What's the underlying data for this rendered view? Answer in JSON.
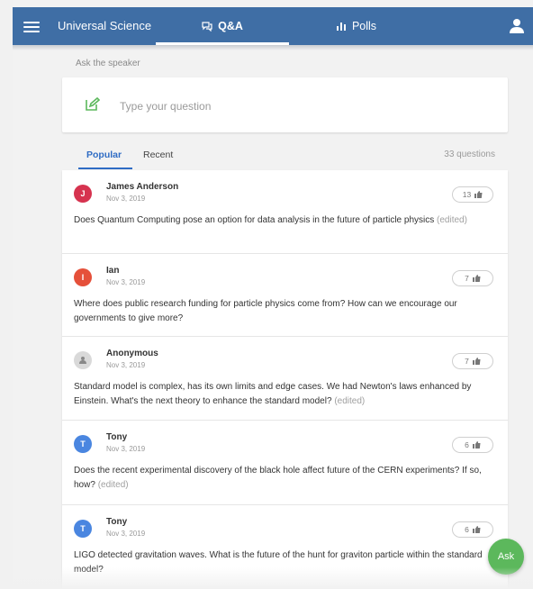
{
  "header": {
    "brand": "Universal Science",
    "tabs": [
      {
        "label": "Q&A",
        "icon": "chat-bubbles-icon",
        "active": true
      },
      {
        "label": "Polls",
        "icon": "bar-chart-icon",
        "active": false
      }
    ],
    "colors": {
      "bar": "#3f6ea5",
      "text": "#ffffff"
    }
  },
  "ask": {
    "label": "Ask the speaker",
    "placeholder": "Type your question",
    "accent": "#5cb85c"
  },
  "sort": {
    "tabs": [
      "Popular",
      "Recent"
    ],
    "active": "Popular",
    "count": "33 questions",
    "accent": "#2f6cc4"
  },
  "questions": [
    {
      "initial": "J",
      "author": "James Anderson",
      "date": "Nov 3, 2019",
      "likes": "13",
      "text": "Does Quantum Computing pose an option for data analysis in the future of particle physics",
      "edited": "(edited)",
      "avatar_color": "#d6334f"
    },
    {
      "initial": "I",
      "author": "Ian",
      "date": "Nov 3, 2019",
      "likes": "7",
      "text": "Where does public research funding for particle physics come from? How can we encourage our governments to give more?",
      "edited": "",
      "avatar_color": "#e5503a"
    },
    {
      "initial": "",
      "author": "Anonymous",
      "date": "Nov 3, 2019",
      "likes": "7",
      "text": "Standard model is complex, has its own limits and edge cases. We had Newton's laws enhanced by Einstein. What's the next theory to enhance the standard model?",
      "edited": "(edited)",
      "avatar_color": "#d9d9d9"
    },
    {
      "initial": "T",
      "author": "Tony",
      "date": "Nov 3, 2019",
      "likes": "6",
      "text": "Does the recent experimental discovery of the black hole affect future of the CERN experiments? If so, how?",
      "edited": "(edited)",
      "avatar_color": "#4a86e0"
    },
    {
      "initial": "T",
      "author": "Tony",
      "date": "Nov 3, 2019",
      "likes": "6",
      "text": "LIGO detected gravitation waves. What is the future of the hunt for graviton particle within the standard model?",
      "edited": "",
      "avatar_color": "#4a86e0"
    }
  ],
  "fab": {
    "label": "Ask",
    "color": "#5cb85c"
  }
}
